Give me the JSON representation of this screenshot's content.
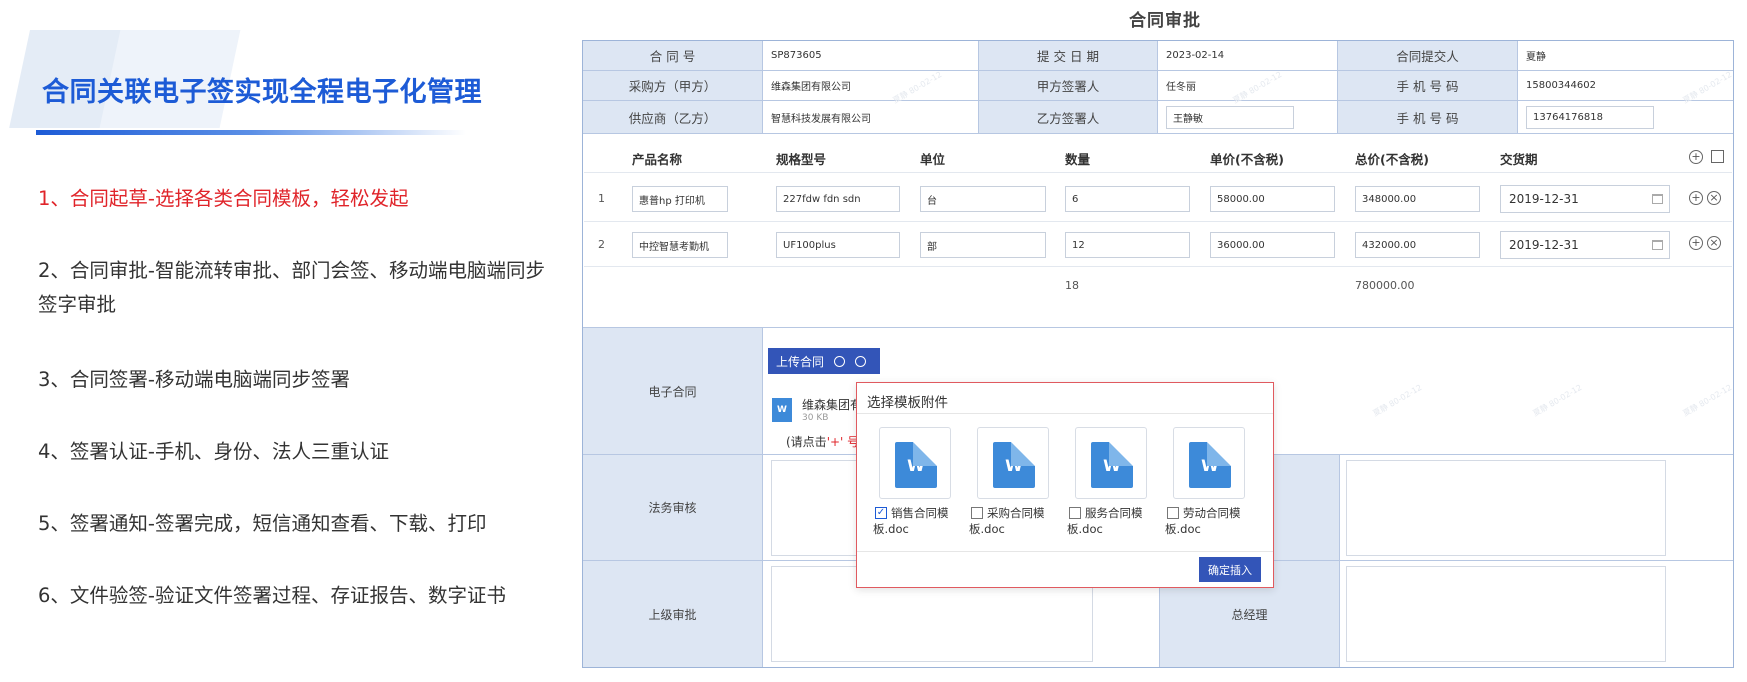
{
  "left_panel": {
    "title": "合同关联电子签实现全程电子化管理",
    "features": [
      "1、合同起草-选择各类合同模板，轻松发起",
      "2、合同审批-智能流转审批、部门会签、移动端电脑端同步签字审批",
      "3、合同签署-移动端电脑端同步签署",
      "4、签署认证-手机、身份、法人三重认证",
      "5、签署通知-签署完成，短信通知查看、下载、打印",
      "6、文件验签-验证文件签署过程、存证报告、数字证书"
    ]
  },
  "form": {
    "title": "合同审批",
    "header": {
      "contract_no_label": "合 同 号",
      "contract_no": "SP873605",
      "submit_date_label": "提 交 日 期",
      "submit_date": "2023-02-14",
      "submitter_label": "合同提交人",
      "submitter": "夏静",
      "buyer_label": "采购方（甲方）",
      "buyer": "维森集团有限公司",
      "party_a_signer_label": "甲方签署人",
      "party_a_signer": "任冬丽",
      "phone_label_1": "手 机 号 码",
      "phone_1": "15800344602",
      "supplier_label": "供应商（乙方）",
      "supplier": "智慧科技发展有限公司",
      "party_b_signer_label": "乙方签署人",
      "party_b_signer": "王静敏",
      "phone_label_2": "手 机 号 码",
      "phone_2": "13764176818"
    },
    "products": {
      "columns": [
        "产品名称",
        "规格型号",
        "单位",
        "数量",
        "单价(不含税)",
        "总价(不含税)",
        "交货期"
      ],
      "rows": [
        {
          "no": "1",
          "name": "惠普hp 打印机",
          "model": "227fdw fdn sdn",
          "unit": "台",
          "qty": "6",
          "price": "58000.00",
          "total": "348000.00",
          "date": "2019-12-31"
        },
        {
          "no": "2",
          "name": "中控智慧考勤机",
          "model": "UF100plus",
          "unit": "部",
          "qty": "12",
          "price": "36000.00",
          "total": "432000.00",
          "date": "2019-12-31"
        }
      ],
      "total_qty": "18",
      "total_amount": "780000.00",
      "add_icon": "plus-circle-icon",
      "remove_icon": "close-circle-icon"
    },
    "e_contract_label": "电子合同",
    "upload_label": "上传合同",
    "file": {
      "name": "维森集团有",
      "size": "30 KB"
    },
    "hint_prefix": "(请点击",
    "hint_red": "'+' 号",
    "legal_review_label": "法务审核",
    "superior_label": "上级审批",
    "gm_label": "总经理",
    "watermark": "夏静 80-02-12"
  },
  "dialog": {
    "title": "选择模板附件",
    "templates": [
      {
        "label": "销售合同模板.doc",
        "checked": true
      },
      {
        "label": "采购合同模板.doc",
        "checked": false
      },
      {
        "label": "服务合同模板.doc",
        "checked": false
      },
      {
        "label": "劳动合同模板.doc",
        "checked": false
      }
    ],
    "doc_letter": "W",
    "confirm": "确定插入"
  }
}
